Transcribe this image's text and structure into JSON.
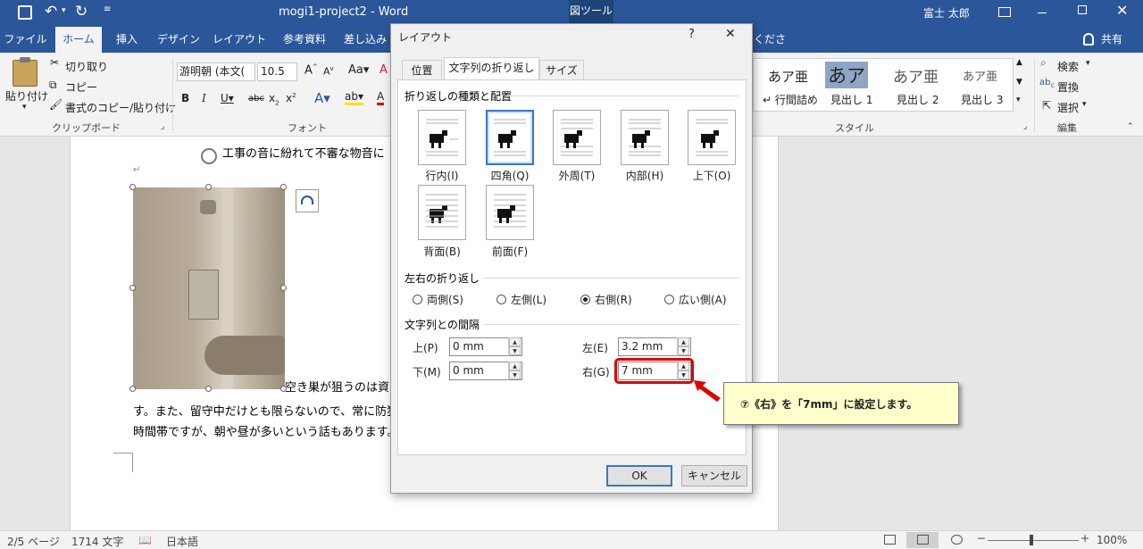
{
  "titlebar": {
    "doc_title": "mogi1-project2 - Word",
    "context_tab": "図ツール",
    "user": "富士 太郎"
  },
  "tabs": {
    "file": "ファイル",
    "home": "ホーム",
    "insert": "挿入",
    "design": "デザイン",
    "layout": "レイアウト",
    "references": "参考資料",
    "mailings": "差し込み",
    "tell_me": "ください",
    "share": "共有"
  },
  "ribbon": {
    "paste": "貼り付け",
    "cut": "切り取り",
    "copy": "コピー",
    "format_painter": "書式のコピー/貼り付け",
    "clipboard_group": "クリップボード",
    "font_name": "游明朝 (本文(",
    "font_size": "10.5",
    "font_group": "フォント",
    "styles": [
      {
        "preview": "あア亜",
        "name": "↵ 行間詰め"
      },
      {
        "preview": "あア",
        "name": "見出し 1"
      },
      {
        "preview": "あア亜",
        "name": "見出し 2"
      },
      {
        "preview": "あア亜",
        "name": "見出し 3"
      }
    ],
    "styles_group": "スタイル",
    "find": "検索",
    "replace": "置換",
    "select": "選択",
    "edit_group": "編集"
  },
  "document": {
    "line1": "工事の音に紛れて不審な物音に",
    "line2a": "空き巣が狙うのは資",
    "line2b": "す。また、留守中だけとも限らないので、常に防犯",
    "line3": "時間帯ですが、朝や昼が多いという話もあります。"
  },
  "dialog": {
    "title": "レイアウト",
    "help": "?",
    "close": "✕",
    "tabs": [
      "位置",
      "文字列の折り返し",
      "サイズ"
    ],
    "wrap_section": "折り返しの種類と配置",
    "wrap_options": [
      {
        "label": "行内(I)",
        "selected": false
      },
      {
        "label": "四角(Q)",
        "selected": true
      },
      {
        "label": "外周(T)",
        "selected": false
      },
      {
        "label": "内部(H)",
        "selected": false
      },
      {
        "label": "上下(O)",
        "selected": false
      },
      {
        "label": "背面(B)",
        "selected": false
      },
      {
        "label": "前面(F)",
        "selected": false
      }
    ],
    "side_section": "左右の折り返し",
    "side_options": [
      {
        "label": "両側(S)",
        "selected": false
      },
      {
        "label": "左側(L)",
        "selected": false
      },
      {
        "label": "右側(R)",
        "selected": true
      },
      {
        "label": "広い側(A)",
        "selected": false
      }
    ],
    "distance_section": "文字列との間隔",
    "top_label": "上(P)",
    "top_value": "0 mm",
    "bottom_label": "下(M)",
    "bottom_value": "0 mm",
    "left_label": "左(E)",
    "left_value": "3.2 mm",
    "right_label": "右(G)",
    "right_value": "7 mm",
    "ok": "OK",
    "cancel": "キャンセル"
  },
  "callout": {
    "text": "⑦《右》を「7mm」に設定します。"
  },
  "status": {
    "page": "2/5 ページ",
    "words": "1714 文字",
    "language": "日本語",
    "zoom": "100%"
  },
  "colors": {
    "brand": "#2b579a",
    "highlight": "#e00000",
    "callout_bg": "#ffffcc"
  }
}
